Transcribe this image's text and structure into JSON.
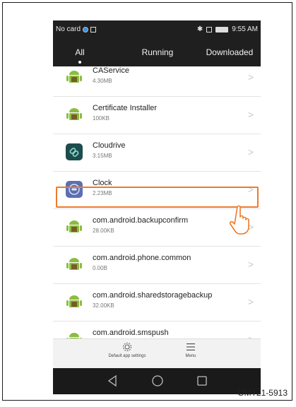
{
  "status": {
    "left_text": "No card",
    "time": "9:55 AM"
  },
  "tabs": [
    {
      "label": "All"
    },
    {
      "label": "Running"
    },
    {
      "label": "Downloaded"
    }
  ],
  "apps": [
    {
      "name": "CAService",
      "size": "4.30MB",
      "icon": "android-icon"
    },
    {
      "name": "Certificate Installer",
      "size": "100KB",
      "icon": "android-icon"
    },
    {
      "name": "Cloudrive",
      "size": "3.15MB",
      "icon": "cloudrive-icon"
    },
    {
      "name": "Clock",
      "size": "2.23MB",
      "icon": "clock-icon"
    },
    {
      "name": "com.android.backupconfirm",
      "size": "28.00KB",
      "icon": "android-icon"
    },
    {
      "name": "com.android.phone.common",
      "size": "0.00B",
      "icon": "android-icon"
    },
    {
      "name": "com.android.sharedstoragebackup",
      "size": "32.00KB",
      "icon": "android-icon"
    },
    {
      "name": "com.android.smspush",
      "size": "",
      "icon": "android-icon"
    }
  ],
  "bottom_actions": {
    "settings_label": "Default app settings",
    "menu_label": "Menu"
  },
  "caption": "OMT21-5913",
  "colors": {
    "highlight": "#ee7a2a",
    "android_green": "#8cbc3f"
  }
}
